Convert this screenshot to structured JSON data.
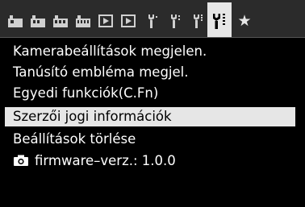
{
  "tabs": [
    {
      "icon": "camera-shooting-icon",
      "active": false
    },
    {
      "icon": "camera-shooting-icon",
      "active": false
    },
    {
      "icon": "camera-shooting-icon",
      "active": false
    },
    {
      "icon": "camera-shooting-icon",
      "active": false
    },
    {
      "icon": "playback-icon",
      "active": false
    },
    {
      "icon": "playback-icon",
      "active": false
    },
    {
      "icon": "setup-wrench-icon",
      "active": false
    },
    {
      "icon": "setup-wrench-icon",
      "active": false
    },
    {
      "icon": "setup-wrench-icon",
      "active": false
    },
    {
      "icon": "setup-wrench-icon",
      "active": true
    },
    {
      "icon": "my-menu-star-icon",
      "active": false
    }
  ],
  "menu": {
    "items": [
      {
        "label": "Kamerabeállítások megjelen."
      },
      {
        "label": "Tanúsító embléma megjel."
      },
      {
        "label": "Egyedi funkciók(C.Fn)"
      },
      {
        "label": "Szerzői jogi információk",
        "selected": true
      },
      {
        "label": "Beállítások törlése"
      },
      {
        "label": "firmware–verz.: 1.0.0",
        "icon": "camera-icon"
      }
    ]
  },
  "colors": {
    "background": "#000000",
    "tabbar": "#2b2b2b",
    "highlight": "#e6e6e6",
    "text": "#ffffff"
  }
}
